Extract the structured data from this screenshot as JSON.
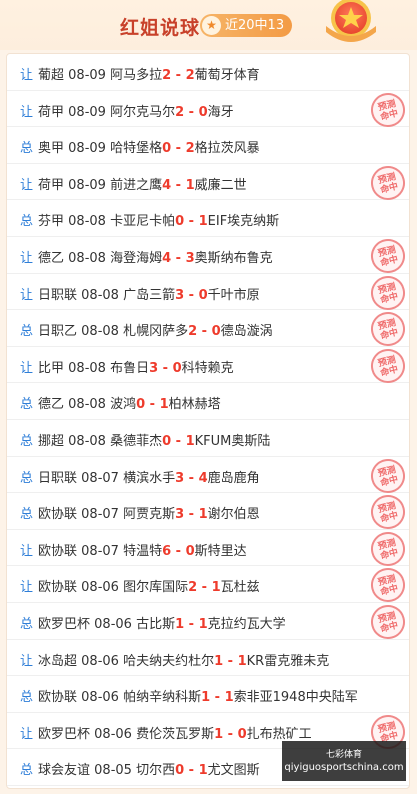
{
  "header": {
    "title": "红姐说球",
    "record_icon": "star-icon",
    "record_text": "近20中13",
    "medal_icon": "star-medal-icon"
  },
  "colors": {
    "accent": "#c8412a",
    "score": "#ee3b2c",
    "type_label": "#2e7ed8",
    "stamp": "#ef6b6b"
  },
  "stamp_text": [
    "预测",
    "命中"
  ],
  "matches": [
    {
      "type": "让",
      "league": "葡超",
      "date": "08-09",
      "home": "阿马多拉",
      "score_home": "2",
      "score_away": "2",
      "away": "葡萄牙体育",
      "hit": false
    },
    {
      "type": "让",
      "league": "荷甲",
      "date": "08-09",
      "home": "阿尔克马尔",
      "score_home": "2",
      "score_away": "0",
      "away": "海牙",
      "hit": true
    },
    {
      "type": "总",
      "league": "奥甲",
      "date": "08-09",
      "home": "哈特堡格",
      "score_home": "0",
      "score_away": "2",
      "away": "格拉茨风暴",
      "hit": false
    },
    {
      "type": "让",
      "league": "荷甲",
      "date": "08-09",
      "home": "前进之鹰",
      "score_home": "4",
      "score_away": "1",
      "away": "威廉二世",
      "hit": true
    },
    {
      "type": "总",
      "league": "芬甲",
      "date": "08-08",
      "home": "卡亚尼卡帕",
      "score_home": "0",
      "score_away": "1",
      "away": "EIF埃克纳斯",
      "hit": false
    },
    {
      "type": "让",
      "league": "德乙",
      "date": "08-08",
      "home": "海登海姆",
      "score_home": "4",
      "score_away": "3",
      "away": "奥斯纳布鲁克",
      "hit": true
    },
    {
      "type": "让",
      "league": "日职联",
      "date": "08-08",
      "home": "广岛三箭",
      "score_home": "3",
      "score_away": "0",
      "away": "千叶市原",
      "hit": true
    },
    {
      "type": "总",
      "league": "日职乙",
      "date": "08-08",
      "home": "札幌冈萨多",
      "score_home": "2",
      "score_away": "0",
      "away": "德岛漩涡",
      "hit": true
    },
    {
      "type": "让",
      "league": "比甲",
      "date": "08-08",
      "home": "布鲁日",
      "score_home": "3",
      "score_away": "0",
      "away": "科特赖克",
      "hit": true
    },
    {
      "type": "总",
      "league": "德乙",
      "date": "08-08",
      "home": "波鸿",
      "score_home": "0",
      "score_away": "1",
      "away": "柏林赫塔",
      "hit": false
    },
    {
      "type": "总",
      "league": "挪超",
      "date": "08-08",
      "home": "桑德菲杰",
      "score_home": "0",
      "score_away": "1",
      "away": "KFUM奥斯陆",
      "hit": false
    },
    {
      "type": "总",
      "league": "日职联",
      "date": "08-07",
      "home": "横滨水手",
      "score_home": "3",
      "score_away": "4",
      "away": "鹿岛鹿角",
      "hit": true
    },
    {
      "type": "总",
      "league": "欧协联",
      "date": "08-07",
      "home": "阿贾克斯",
      "score_home": "3",
      "score_away": "1",
      "away": "谢尔伯恩",
      "hit": true
    },
    {
      "type": "让",
      "league": "欧协联",
      "date": "08-07",
      "home": "特温特",
      "score_home": "6",
      "score_away": "0",
      "away": "斯特里达",
      "hit": true
    },
    {
      "type": "让",
      "league": "欧协联",
      "date": "08-06",
      "home": "图尔库国际",
      "score_home": "2",
      "score_away": "1",
      "away": "瓦杜兹",
      "hit": true
    },
    {
      "type": "总",
      "league": "欧罗巴杯",
      "date": "08-06",
      "home": "古比斯",
      "score_home": "1",
      "score_away": "1",
      "away": "克拉约瓦大学",
      "hit": true
    },
    {
      "type": "让",
      "league": "冰岛超",
      "date": "08-06",
      "home": "哈夫纳夫约杜尔",
      "score_home": "1",
      "score_away": "1",
      "away": "KR雷克雅未克",
      "hit": false
    },
    {
      "type": "总",
      "league": "欧协联",
      "date": "08-06",
      "home": "帕纳辛纳科斯",
      "score_home": "1",
      "score_away": "1",
      "away": "索非亚1948中央陆军",
      "hit": false
    },
    {
      "type": "让",
      "league": "欧罗巴杯",
      "date": "08-06",
      "home": "费伦茨瓦罗斯",
      "score_home": "1",
      "score_away": "0",
      "away": "扎布热矿工",
      "hit": true
    },
    {
      "type": "总",
      "league": "球会友谊",
      "date": "08-05",
      "home": "切尔西",
      "score_home": "0",
      "score_away": "1",
      "away": "尤文图斯",
      "hit": false
    }
  ],
  "watermark": {
    "top_text": "七彩体育",
    "url": "qiyiguosportschina.com"
  }
}
